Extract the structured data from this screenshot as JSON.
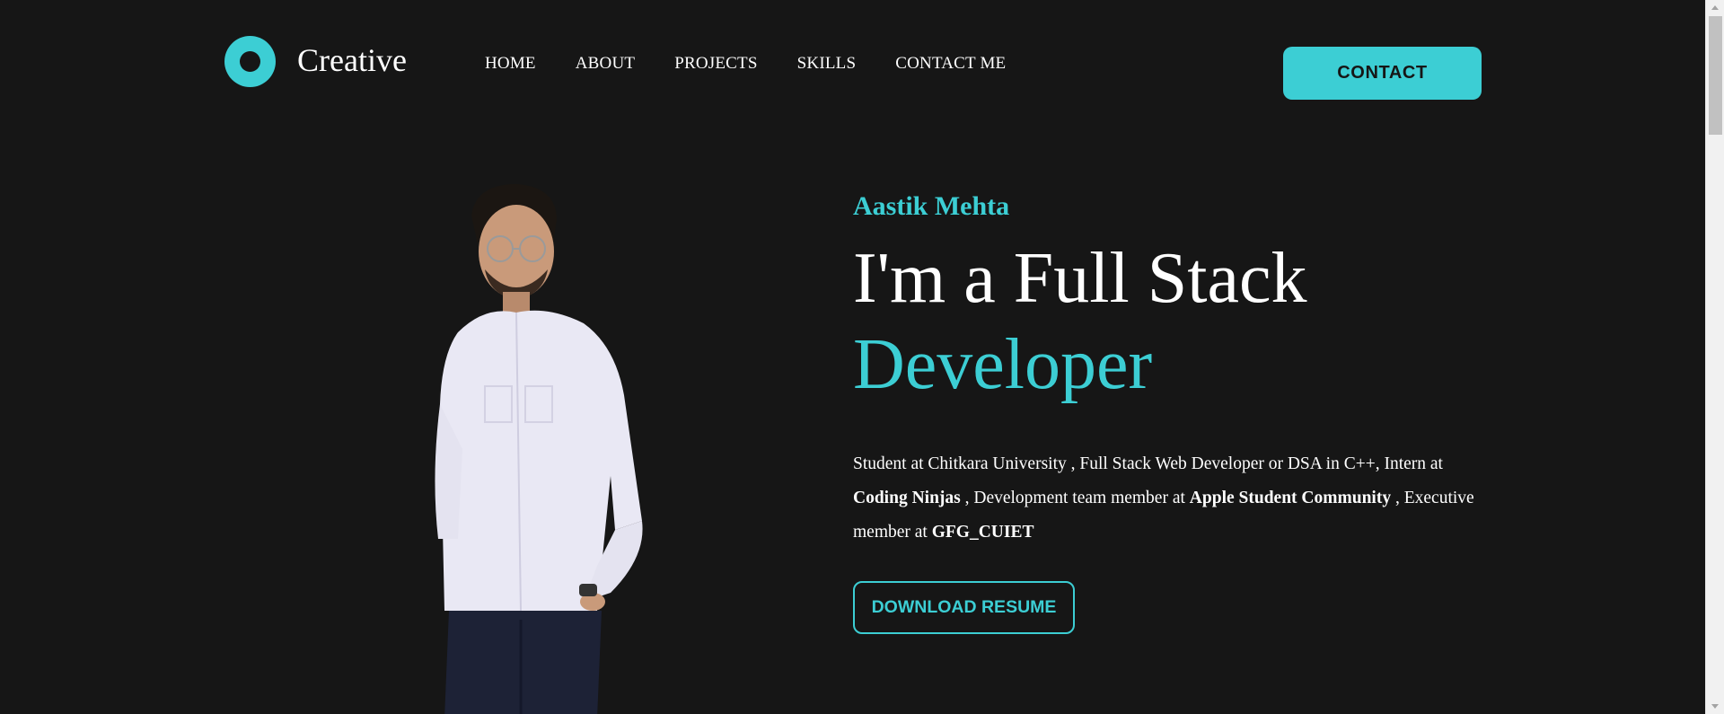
{
  "brand": {
    "name": "Creative",
    "logo_icon": "ring-logo-icon",
    "accent_color": "#3cced4",
    "background_color": "#161616"
  },
  "nav": {
    "items": [
      {
        "label": "HOME"
      },
      {
        "label": "ABOUT"
      },
      {
        "label": "PROJECTS"
      },
      {
        "label": "SKILLS"
      },
      {
        "label": "CONTACT ME"
      }
    ]
  },
  "header": {
    "contact_label": "CONTACT"
  },
  "hero": {
    "name": "Aastik Mehta",
    "title_line1": "I'm a Full Stack",
    "title_line2": "Developer",
    "desc": {
      "part1": "Student at Chitkara University , Full Stack Web Developer or DSA in C++, Intern at ",
      "bold1": "Coding Ninjas",
      "part2": " , Development team member at ",
      "bold2": "Apple Student Community",
      "part3": " , Executive member at ",
      "bold3": "GFG_CUIET"
    },
    "resume_label": "DOWNLOAD RESUME",
    "portrait_icon": "person-portrait-image"
  }
}
